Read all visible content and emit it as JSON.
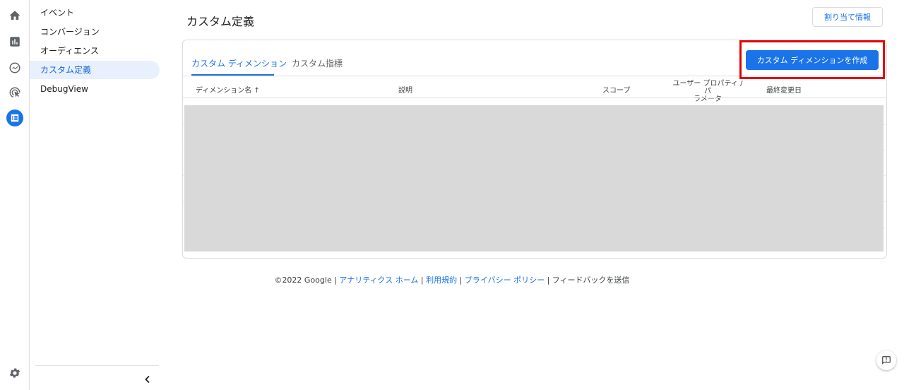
{
  "rail": {
    "icons": [
      "home-icon",
      "reports-icon",
      "explore-icon",
      "advertising-icon",
      "configure-icon",
      "admin-gear-icon"
    ],
    "active_index": 4,
    "active_color": "#1a73e8"
  },
  "sidebar": {
    "items": [
      {
        "label": "イベント"
      },
      {
        "label": "コンバージョン"
      },
      {
        "label": "オーディエンス"
      },
      {
        "label": "カスタム定義",
        "active": true
      },
      {
        "label": "DebugView"
      }
    ],
    "collapse_icon": "chevron-left-icon"
  },
  "main": {
    "title": "カスタム定義",
    "assign_button": "割り当て情報",
    "tabs": [
      {
        "label": "カスタム ディメンション",
        "active": true
      },
      {
        "label": "カスタム指標"
      }
    ],
    "create_button": "カスタム ディメンションを作成",
    "table": {
      "columns": {
        "dimension_name": "ディメンション名",
        "sort_arrow": "↑",
        "description": "説明",
        "scope": "スコープ",
        "user_property_line1": "ユーザー プロパティ / パ",
        "user_property_line2": "ラメータ",
        "last_modified": "最終変更日"
      }
    }
  },
  "footer": {
    "copyright": "©2022 Google",
    "separator": " | ",
    "links": {
      "analytics_home": "アナリティクス ホーム",
      "terms": "利用規約",
      "privacy": "プライバシー ポリシー"
    },
    "feedback": "フィードバックを送信"
  },
  "colors": {
    "accent": "#1a73e8",
    "highlight": "#e50000",
    "active_bg": "#e8f0fe"
  }
}
